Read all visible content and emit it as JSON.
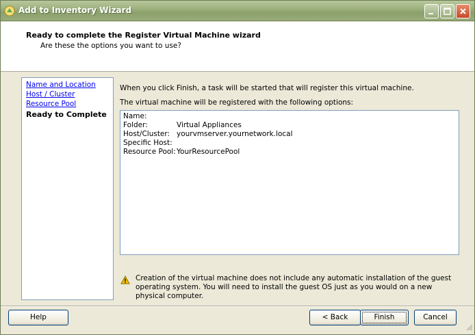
{
  "window": {
    "title": "Add to Inventory Wizard",
    "icon": "vm-inventory-icon",
    "controls": [
      "minimize-icon",
      "maximize-icon",
      "close-icon"
    ]
  },
  "header": {
    "title": "Ready to complete the Register Virtual Machine wizard",
    "subtitle": "Are these the options you want to use?"
  },
  "nav": {
    "items": [
      {
        "label": "Name and Location",
        "state": "link"
      },
      {
        "label": "Host / Cluster",
        "state": "link"
      },
      {
        "label": "Resource Pool",
        "state": "link"
      },
      {
        "label": "Ready to Complete",
        "state": "current"
      }
    ]
  },
  "main": {
    "intro": "When you click Finish, a task will be started that will register this virtual machine.",
    "options_label": "The virtual machine will be registered with the following options:",
    "options": [
      {
        "key": "Name:",
        "value": ""
      },
      {
        "key": "Folder:",
        "value": "Virtual Appliances"
      },
      {
        "key": "Host/Cluster:",
        "value": "yourvmserver.yournetwork.local"
      },
      {
        "key": "Specific Host:",
        "value": ""
      },
      {
        "key": "Resource Pool:",
        "value": "YourResourcePool"
      }
    ],
    "warning": "Creation of the virtual machine does not include any automatic installation of the guest operating system. You will need to install the guest OS just as you would on a new physical computer."
  },
  "footer": {
    "help_label": "Help",
    "back_label": "< Back",
    "finish_label": "Finish",
    "cancel_label": "Cancel"
  },
  "colors": {
    "titlebar": "#98ab79",
    "link": "#0000ee",
    "warning": "#f2c200"
  }
}
